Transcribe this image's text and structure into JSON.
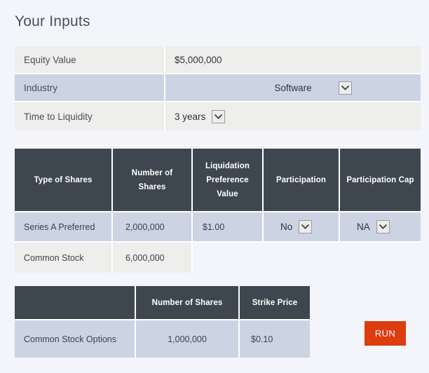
{
  "page": {
    "title": "Your Inputs",
    "background_color": "#f4f5fa"
  },
  "colors": {
    "header_dark": "#3e4750",
    "row_blue": "#ccd3e3",
    "row_gray": "#eeeeec",
    "run_button": "#dd3c0f",
    "text": "#3d4349"
  },
  "inputs_table": {
    "rows": [
      {
        "label": "Equity Value",
        "value": "$5,000,000",
        "type": "text",
        "highlight": false
      },
      {
        "label": "Industry",
        "value": "Software",
        "type": "select",
        "highlight": true
      },
      {
        "label": "Time to Liquidity",
        "value": "3 years",
        "type": "select",
        "highlight": false
      }
    ]
  },
  "shares_table": {
    "headers": [
      "Type of Shares",
      "Number of Shares",
      "Liquidation Preference Value",
      "Participation",
      "Participation Cap"
    ],
    "rows": [
      {
        "type_of_shares": "Series A Preferred",
        "number_of_shares": "2,000,000",
        "liquidation_preference_value": "$1.00",
        "participation": "No",
        "participation_cap": "NA"
      },
      {
        "type_of_shares": "Common Stock",
        "number_of_shares": "6,000,000",
        "liquidation_preference_value": "",
        "participation": "",
        "participation_cap": ""
      }
    ]
  },
  "options_table": {
    "headers": [
      "",
      "Number of Shares",
      "Strike Price"
    ],
    "rows": [
      {
        "name": "Common Stock Options",
        "number_of_shares": "1,000,000",
        "strike_price": "$0.10"
      }
    ]
  },
  "actions": {
    "run_label": "RUN"
  },
  "icons": {
    "chevron_down": "chevron-down-icon"
  }
}
